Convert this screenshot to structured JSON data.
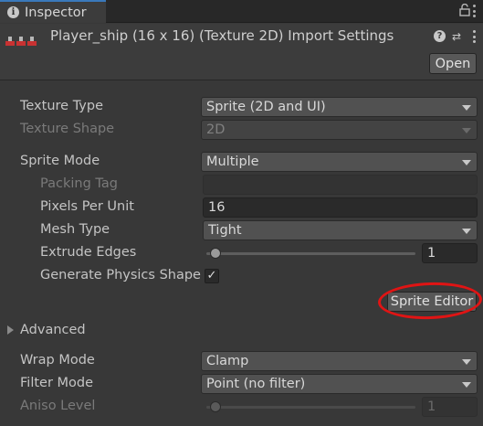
{
  "tab": {
    "label": "Inspector"
  },
  "header": {
    "title": "Player_ship (16 x 16) (Texture 2D) Import Settings",
    "open_button": "Open"
  },
  "properties": {
    "texture_type": {
      "label": "Texture Type",
      "value": "Sprite (2D and UI)"
    },
    "texture_shape": {
      "label": "Texture Shape",
      "value": "2D"
    },
    "sprite_mode": {
      "label": "Sprite Mode",
      "value": "Multiple"
    },
    "packing_tag": {
      "label": "Packing Tag",
      "value": ""
    },
    "pixels_per_unit": {
      "label": "Pixels Per Unit",
      "value": "16"
    },
    "mesh_type": {
      "label": "Mesh Type",
      "value": "Tight"
    },
    "extrude_edges": {
      "label": "Extrude Edges",
      "value": "1",
      "slider_fraction": 0.0
    },
    "generate_physics_shape": {
      "label": "Generate Physics Shape",
      "checked": true,
      "check_glyph": "✓"
    },
    "sprite_editor_button": "Sprite Editor",
    "advanced": {
      "label": "Advanced"
    },
    "wrap_mode": {
      "label": "Wrap Mode",
      "value": "Clamp"
    },
    "filter_mode": {
      "label": "Filter Mode",
      "value": "Point (no filter)"
    },
    "aniso_level": {
      "label": "Aniso Level",
      "value": "1",
      "slider_fraction": 0.0
    }
  },
  "icons": {
    "tab": "info-icon",
    "lock": "lock-icon",
    "help": "help-icon",
    "presets": "presets-icon",
    "menu": "kebab-menu-icon"
  },
  "colors": {
    "tab_accent": "#3a79bb",
    "highlight_ring": "#e01414"
  }
}
